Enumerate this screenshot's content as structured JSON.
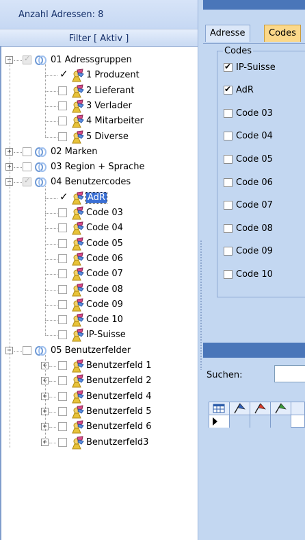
{
  "header": {
    "address_count": "Anzahl Adressen: 8",
    "filter_title": "Filter [ Aktiv ]"
  },
  "tree": {
    "groups": [
      {
        "label": "01 Adressgruppen",
        "expanded": true,
        "checked": "partial",
        "children": [
          {
            "label": "1 Produzent",
            "checked": true
          },
          {
            "label": "2 Lieferant",
            "checked": false
          },
          {
            "label": "3 Verlader",
            "checked": false
          },
          {
            "label": "4 Mitarbeiter",
            "checked": false
          },
          {
            "label": "5 Diverse",
            "checked": false
          }
        ]
      },
      {
        "label": "02 Marken",
        "expanded": false,
        "checked": false,
        "children": []
      },
      {
        "label": "03 Region + Sprache",
        "expanded": false,
        "checked": false,
        "children": []
      },
      {
        "label": "04 Benutzercodes",
        "expanded": true,
        "checked": "partial",
        "children": [
          {
            "label": "AdR",
            "checked": true,
            "selected": true
          },
          {
            "label": "Code 03",
            "checked": false
          },
          {
            "label": "Code 04",
            "checked": false
          },
          {
            "label": "Code 05",
            "checked": false
          },
          {
            "label": "Code 06",
            "checked": false
          },
          {
            "label": "Code 07",
            "checked": false
          },
          {
            "label": "Code 08",
            "checked": false
          },
          {
            "label": "Code 09",
            "checked": false
          },
          {
            "label": "Code 10",
            "checked": false
          },
          {
            "label": "IP-Suisse",
            "checked": false
          }
        ]
      },
      {
        "label": "05 Benutzerfelder",
        "expanded": true,
        "checked": false,
        "children": [
          {
            "label": "Benutzerfeld 1",
            "checked": false,
            "expandable": true
          },
          {
            "label": "Benutzerfeld 2",
            "checked": false,
            "expandable": true
          },
          {
            "label": "Benutzerfeld 4",
            "checked": false,
            "expandable": true
          },
          {
            "label": "Benutzerfeld 5",
            "checked": false,
            "expandable": true
          },
          {
            "label": "Benutzerfeld 6",
            "checked": false,
            "expandable": true
          },
          {
            "label": "Benutzerfeld3",
            "checked": false,
            "expandable": true
          }
        ]
      }
    ]
  },
  "tabs": [
    {
      "label": "Adresse",
      "active": false
    },
    {
      "label": "Codes",
      "active": true
    }
  ],
  "codes": {
    "legend": "Codes",
    "items": [
      {
        "label": "IP-Suisse",
        "checked": true
      },
      {
        "label": "AdR",
        "checked": true
      },
      {
        "label": "Code 03",
        "checked": false
      },
      {
        "label": "Code 04",
        "checked": false
      },
      {
        "label": "Code 05",
        "checked": false
      },
      {
        "label": "Code 06",
        "checked": false
      },
      {
        "label": "Code 07",
        "checked": false
      },
      {
        "label": "Code 08",
        "checked": false
      },
      {
        "label": "Code 09",
        "checked": false
      },
      {
        "label": "Code 10",
        "checked": false
      }
    ]
  },
  "search": {
    "label": "Suchen:",
    "value": ""
  },
  "icons": {
    "group": "rings-icon",
    "item": "person-pin-icon",
    "grid": "table-icon",
    "flag_colors": [
      "#2f5fb8",
      "#d63b2a",
      "#3a9a3a"
    ]
  }
}
